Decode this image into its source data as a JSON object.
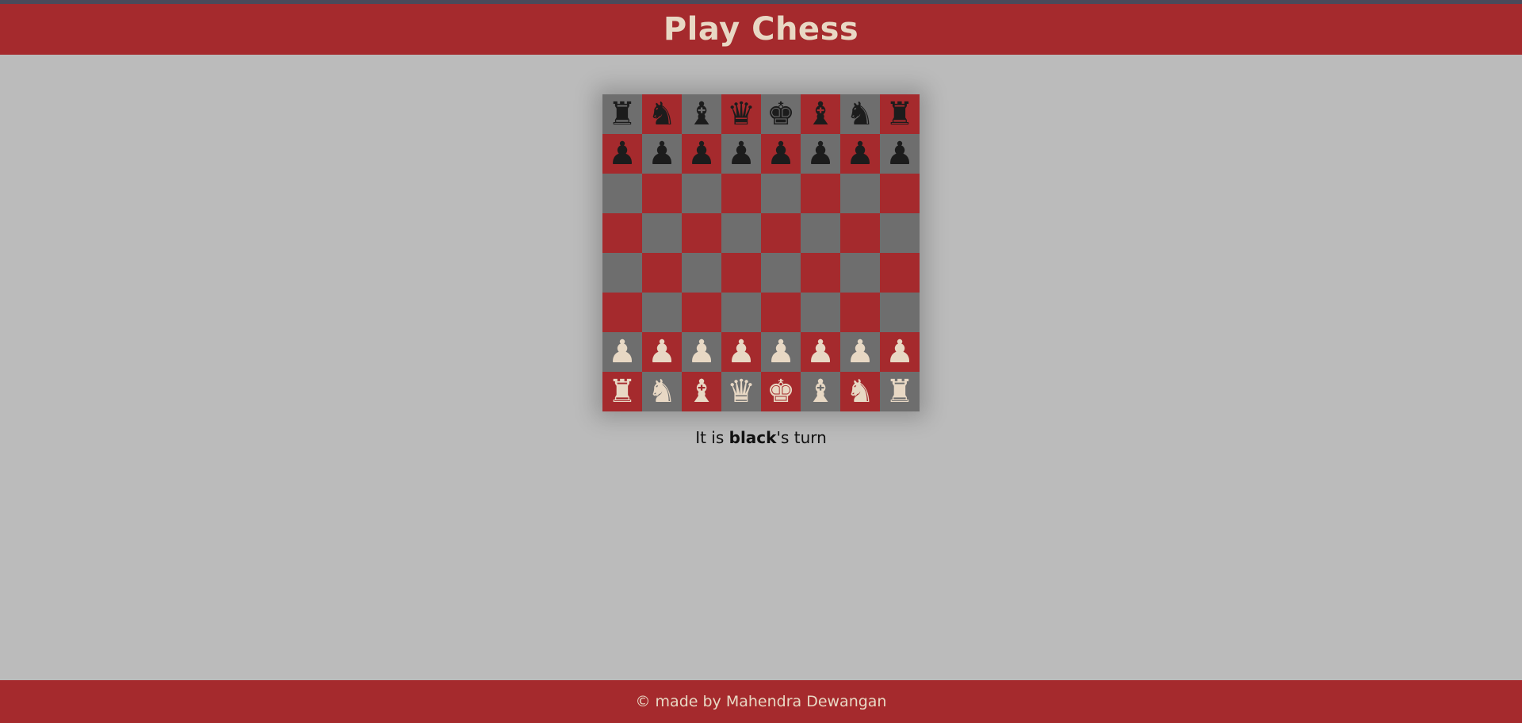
{
  "header": {
    "title": "Play Chess"
  },
  "colors": {
    "header_bg": "#a52a2d",
    "page_bg": "#bbbbbb",
    "light_square": "#6e6e6e",
    "dark_square": "#a52a2d",
    "white_piece": "#e8d8c4",
    "black_piece": "#1c1c1c"
  },
  "board": {
    "rows": [
      [
        "br",
        "bn",
        "bb",
        "bq",
        "bk",
        "bb",
        "bn",
        "br"
      ],
      [
        "bp",
        "bp",
        "bp",
        "bp",
        "bp",
        "bp",
        "bp",
        "bp"
      ],
      [
        "",
        "",
        "",
        "",
        "",
        "",
        "",
        ""
      ],
      [
        "",
        "",
        "",
        "",
        "",
        "",
        "",
        ""
      ],
      [
        "",
        "",
        "",
        "",
        "",
        "",
        "",
        ""
      ],
      [
        "",
        "",
        "",
        "",
        "",
        "",
        "",
        ""
      ],
      [
        "wp",
        "wp",
        "wp",
        "wp",
        "wp",
        "wp",
        "wp",
        "wp"
      ],
      [
        "wr",
        "wn",
        "wb",
        "wq",
        "wk",
        "wb",
        "wn",
        "wr"
      ]
    ],
    "piece_icons": {
      "r": "rook-icon",
      "n": "knight-icon",
      "b": "bishop-icon",
      "q": "queen-icon",
      "k": "king-icon",
      "p": "pawn-icon"
    }
  },
  "status": {
    "prefix": "It is ",
    "player": "black",
    "suffix": "'s turn"
  },
  "footer": {
    "text": "© made by Mahendra Dewangan"
  }
}
